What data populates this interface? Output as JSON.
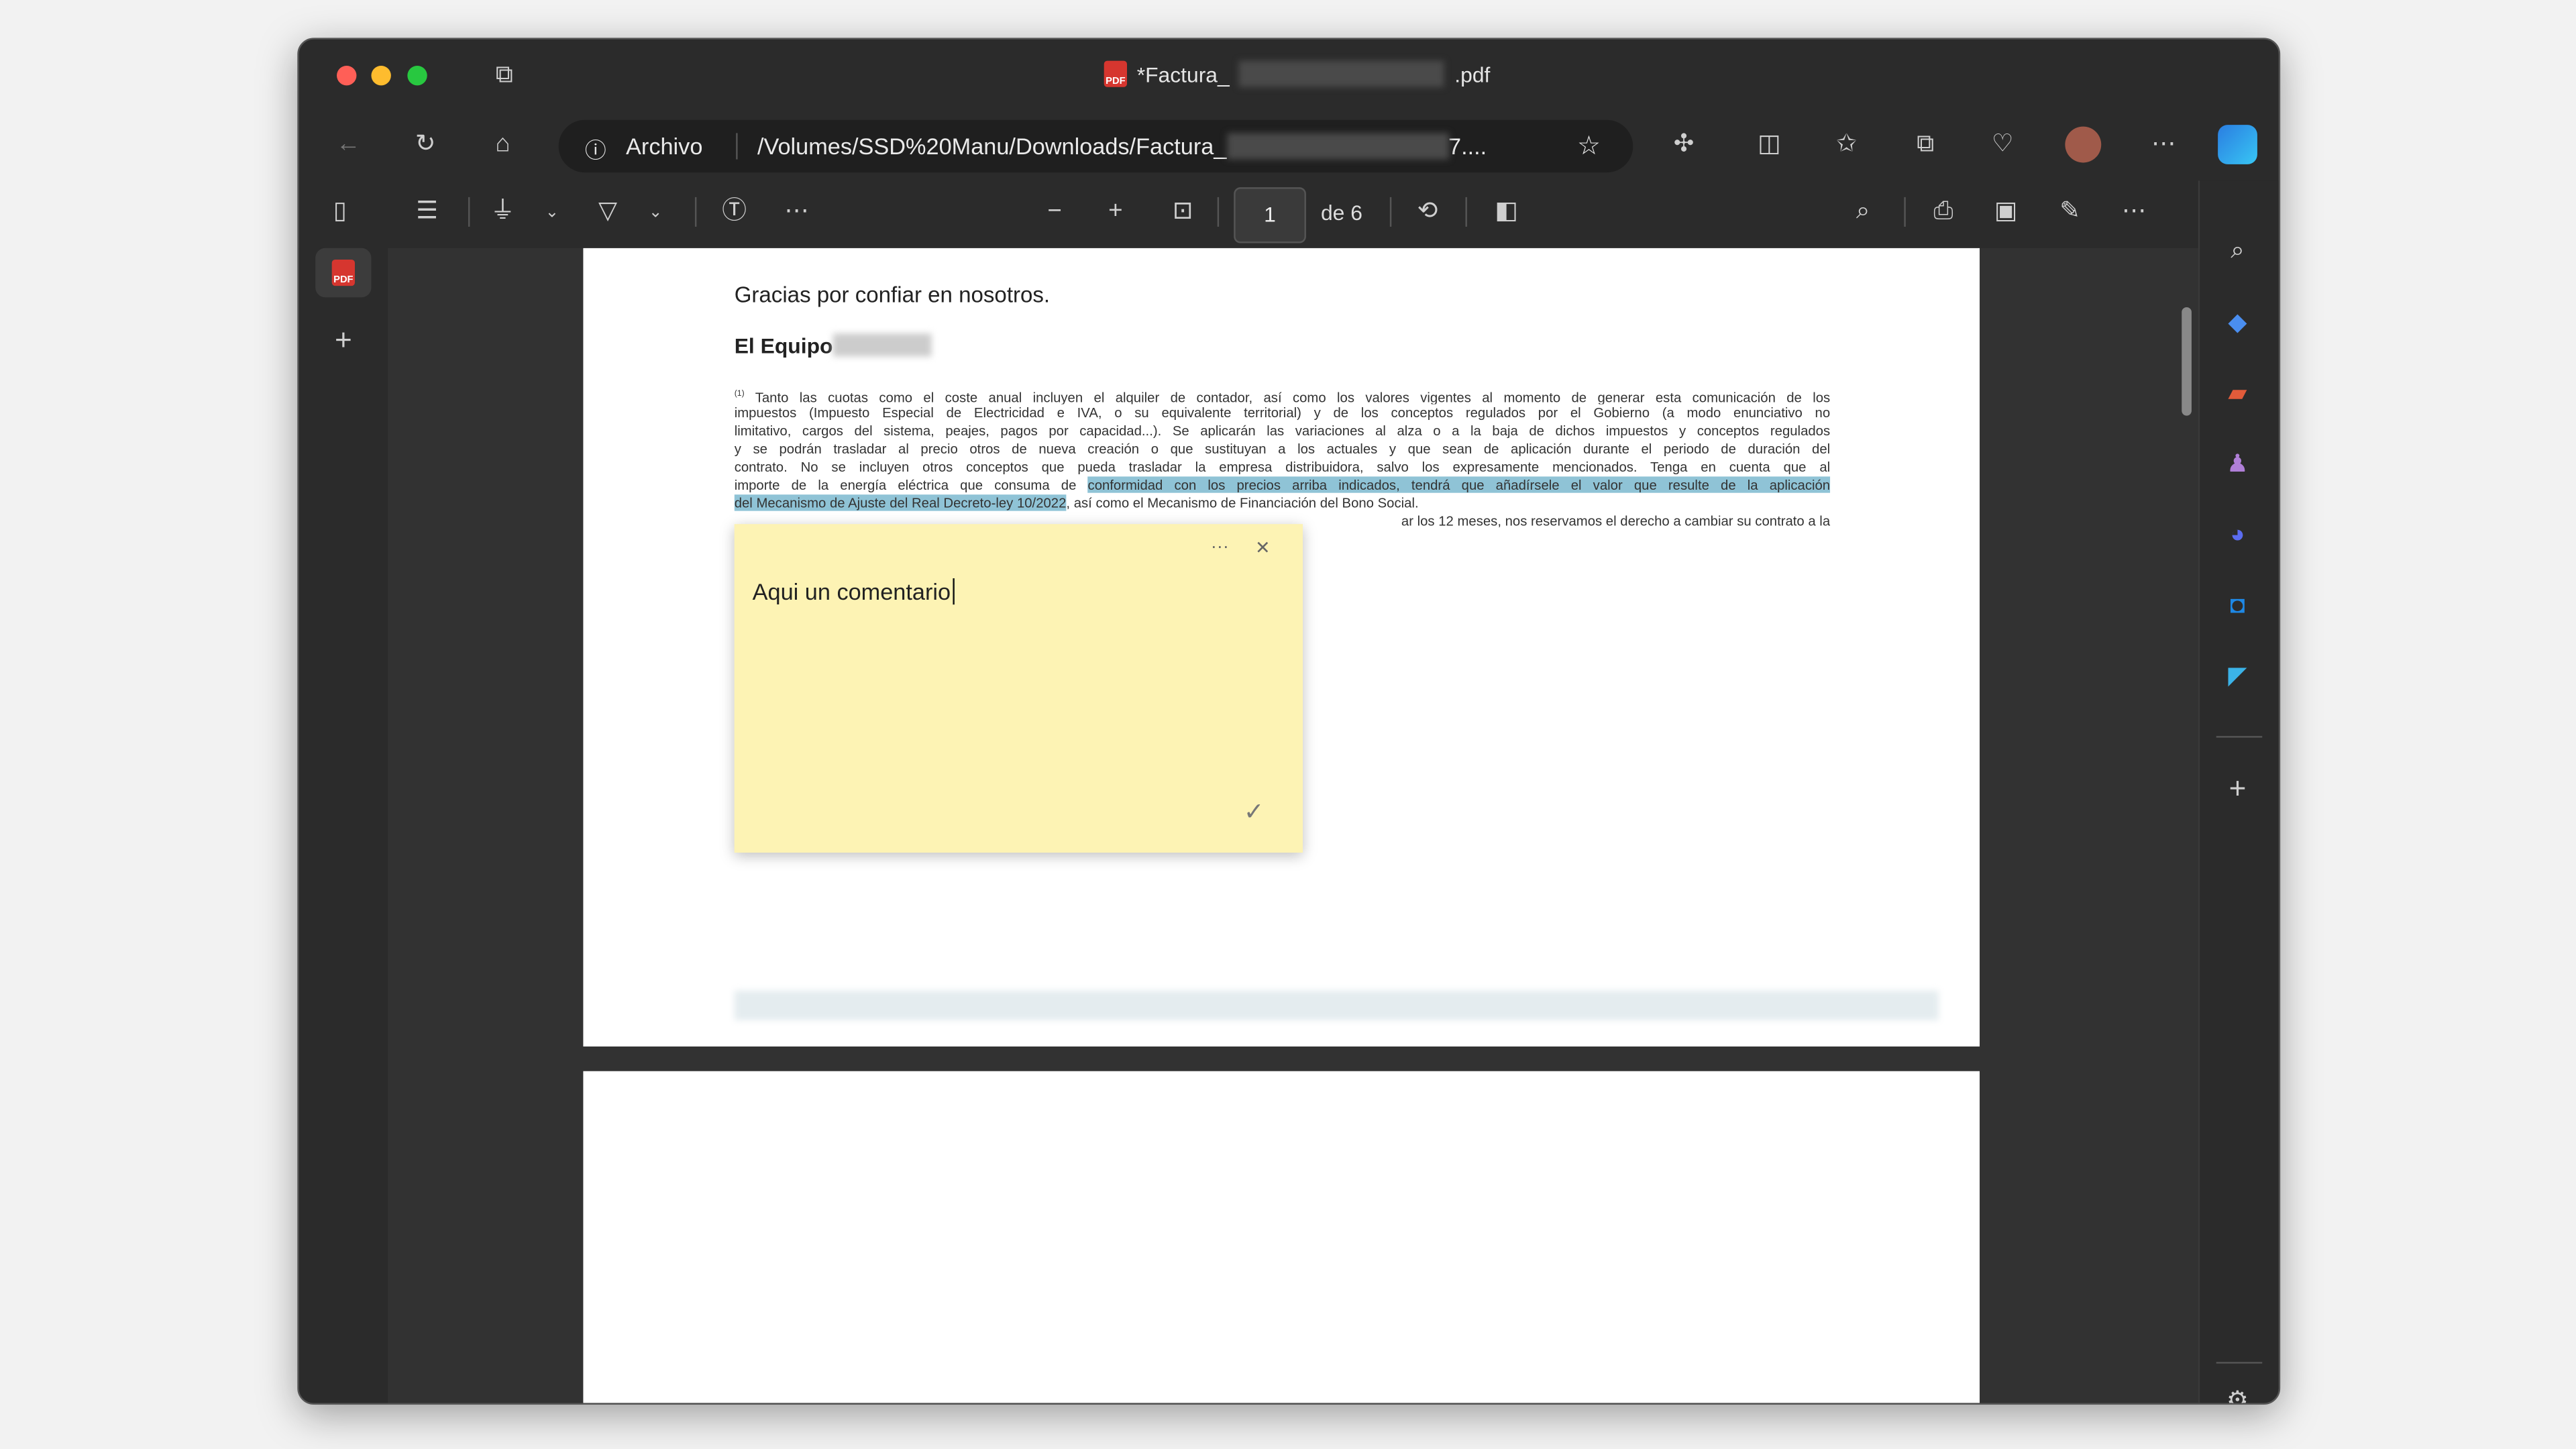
{
  "window": {
    "title_prefix": "*Factura_",
    "title_suffix": ".pdf",
    "traffic_colors": {
      "close": "#ff5f57",
      "minimize": "#febc2e",
      "zoom": "#28c840"
    }
  },
  "address_bar": {
    "scheme_label": "Archivo",
    "url_prefix": "/Volumes/SSD%20Manu/Downloads/Factura_",
    "url_suffix": "7...."
  },
  "pdf_toolbar": {
    "page_current": "1",
    "page_total_label": "de 6"
  },
  "document": {
    "thanks": "Gracias por confiar en nosotros.",
    "signature_prefix": "El Equipo",
    "footnote_marker": "(1)",
    "footnote_lines": [
      "Tanto las cuotas como el coste anual incluyen el alquiler de contador, así como los valores vigentes al momento de generar esta comunicación de los",
      "impuestos (Impuesto Especial de Electricidad e IVA, o su equivalente territorial) y de los conceptos regulados por el Gobierno (a modo enunciativo no",
      "limitativo, cargos del sistema, peajes, pagos por capacidad...). Se aplicarán las variaciones al alza o a la baja de dichos impuestos y conceptos regulados",
      "y se podrán trasladar al precio otros de nueva creación o que sustituyan a los actuales y que sean de aplicación durante el periodo de duración del",
      "contrato. No se incluyen otros conceptos que pueda trasladar la empresa distribuidora, salvo los expresamente mencionados. Tenga en cuenta que al"
    ],
    "line6_plain": "importe de la energía eléctrica que consuma de ",
    "line6_highlight": "conformidad con los precios arriba indicados, tendrá que añadírsele el valor que resulte de la aplicación",
    "line7_highlight": "del Mecanismo de Ajuste del Real Decreto-ley 10/2022",
    "line7_plain": ", así como el Mecanismo de Financiación del Bono Social.",
    "line8_visible": "ar los 12 meses, nos reservamos el derecho a cambiar su contrato a la",
    "highlight_color": "#8fc3d6"
  },
  "comment_note": {
    "text": "Aqui un comentario",
    "more_label": "···",
    "close_label": "✕",
    "confirm_label": "✓",
    "color": "#fdf3b4"
  }
}
